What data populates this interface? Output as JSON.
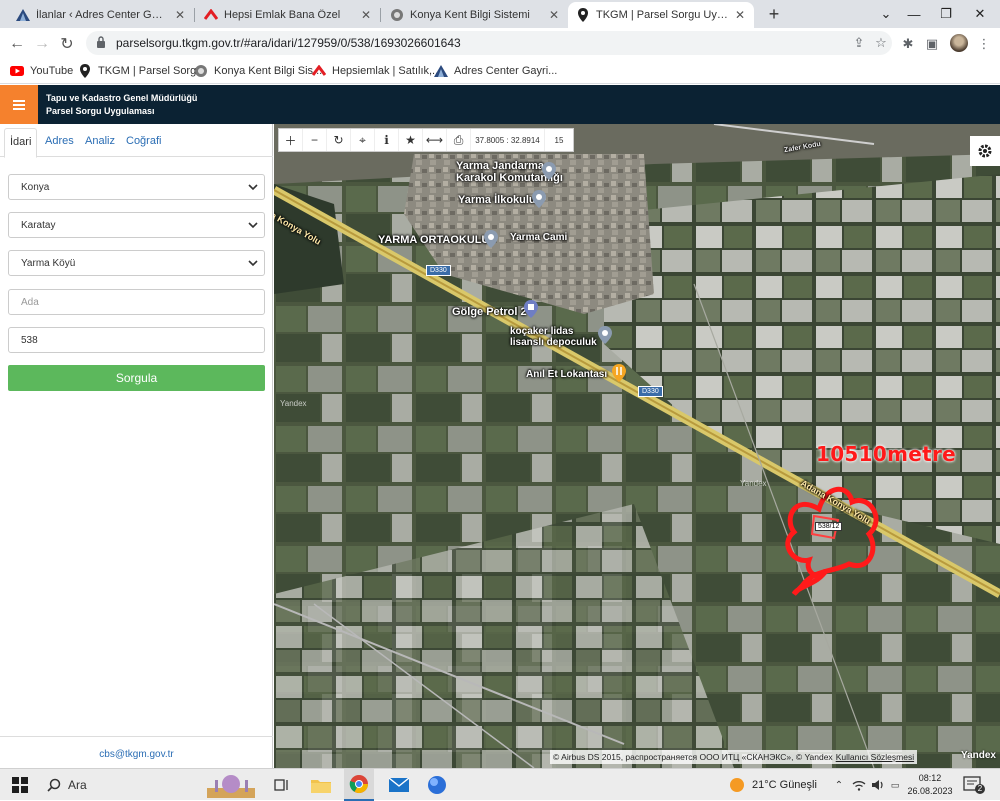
{
  "browser": {
    "tabs": [
      {
        "title": "İlanlar ‹ Adres Center Gayrimenku",
        "icon": "adres-center-icon",
        "active": false
      },
      {
        "title": "Hepsi Emlak Bana Özel",
        "icon": "hepsiemlak-icon",
        "active": false
      },
      {
        "title": "Konya Kent Bilgi Sistemi",
        "icon": "konya-kent-icon",
        "active": false
      },
      {
        "title": "TKGM | Parsel Sorgu Uygulaması",
        "icon": "map-pin-icon",
        "active": true
      }
    ],
    "url": "parselsorgu.tkgm.gov.tr/#ara/idari/127959/0/538/1693026601643",
    "bookmarks": [
      {
        "label": "YouTube",
        "icon": "youtube-icon"
      },
      {
        "label": "TKGM | Parsel Sorg...",
        "icon": "map-pin-icon"
      },
      {
        "label": "Konya Kent Bilgi Sis...",
        "icon": "konya-kent-icon"
      },
      {
        "label": "Hepsiemlak | Satılık,...",
        "icon": "hepsiemlak-icon"
      },
      {
        "label": "Adres Center Gayri...",
        "icon": "adres-center-icon"
      }
    ],
    "colors": {
      "tabbar": "#dee1e6",
      "youtube": "#ff0000",
      "hepsiemlak": "#e31e24"
    }
  },
  "app": {
    "title_line1": "Tapu ve Kadastro Genel Müdürlüğü",
    "title_line2": "Parsel Sorgu Uygulaması",
    "header_color": "#0b2233",
    "menu_color": "#f5812d"
  },
  "panel": {
    "tabs": [
      "İdari",
      "Adres",
      "Analiz",
      "Coğrafi"
    ],
    "active_tab": "İdari",
    "province": "Konya",
    "district": "Karatay",
    "neighborhood": "Yarma Köyü",
    "ada_placeholder": "Ada",
    "parsel_value": "538",
    "search_button": "Sorgula",
    "footer_email": "cbs@tkgm.gov.tr",
    "button_color": "#5cb85c"
  },
  "map": {
    "coordinates": "37.8005 : 32.8914",
    "zoom": "15",
    "tools": [
      "plus-icon",
      "minus-icon",
      "refresh-icon",
      "crosshair-icon",
      "info-icon",
      "star-icon",
      "measure-icon",
      "print-icon"
    ],
    "labels": {
      "jandarma_1": "Yarma Jandarma",
      "jandarma_2": "Karakol Komutanlığı",
      "ilkokul": "Yarma İlkokulu",
      "ortaokul": "YARMA ORTAOKULU",
      "cami": "Yarma Cami",
      "golge": "Gölge Petrol 2",
      "kocaker_1": "koçaker lidas",
      "kocaker_2": "lisanslı depoculuk",
      "anil": "Anıl Et Lokantası",
      "konya_yolu_1": "a Konya Yolu",
      "konya_yolu_2": "Adana Konya Yolu",
      "d330_a": "D330",
      "d330_b": "D330",
      "yandex_a": "Yandex",
      "yandex_b": "Yandex",
      "top_road": "Zafer Kodu"
    },
    "annotation": "10510metre",
    "parcel_label": "538/12",
    "attribution": "© Airbus DS 2015, распространяется ООО ИТЦ «СКАНЭКС», © Yandex",
    "attribution_link": "Kullanıcı Sözleşmesi",
    "brand": "Yandex",
    "annotation_color": "#ff1a1a"
  },
  "taskbar": {
    "search_text": "Ara",
    "weather": "21°C  Güneşli",
    "time": "08:12",
    "date": "26.08.2023",
    "notifications": "2"
  }
}
